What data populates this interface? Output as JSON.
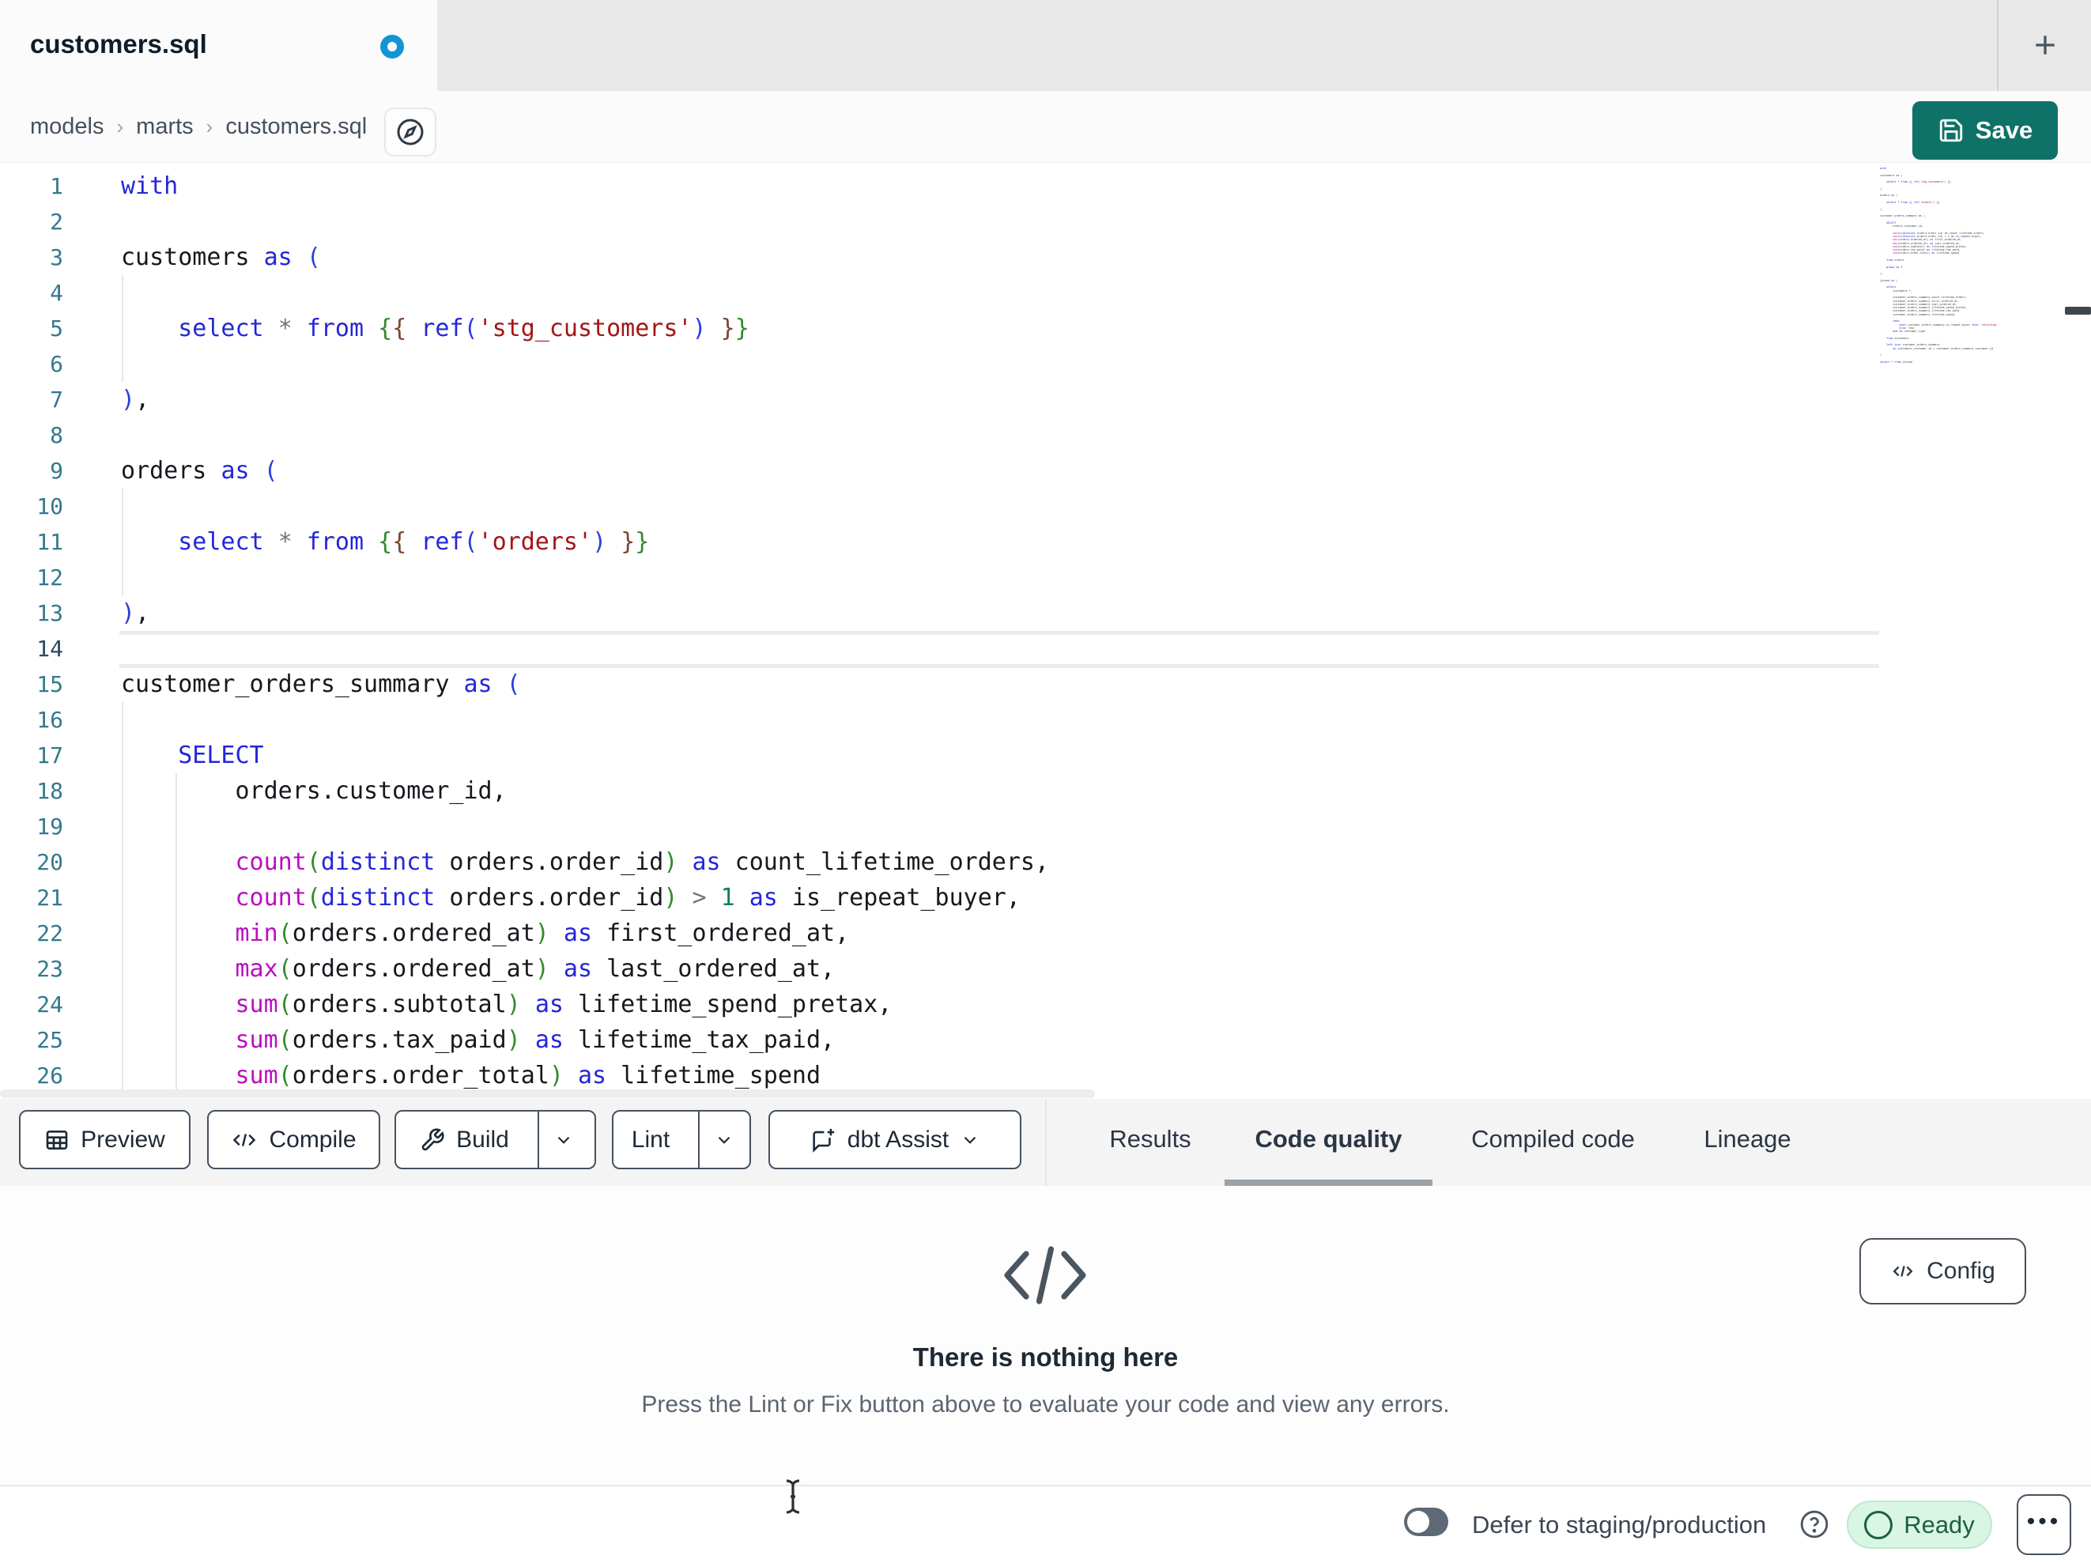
{
  "tab_bar": {
    "tab_title": "customers.sql",
    "unsaved": true,
    "new_tab_label": "+"
  },
  "breadcrumb": {
    "items": [
      "models",
      "marts",
      "customers.sql"
    ],
    "separator": "›"
  },
  "save_button": {
    "label": "Save"
  },
  "toolbar": {
    "preview_label": "Preview",
    "compile_label": "Compile",
    "build_label": "Build",
    "lint_label": "Lint",
    "assist_label": "dbt Assist"
  },
  "tabs": {
    "items": [
      {
        "label": "Results",
        "active": false
      },
      {
        "label": "Code quality",
        "active": true
      },
      {
        "label": "Compiled code",
        "active": false
      },
      {
        "label": "Lineage",
        "active": false
      }
    ]
  },
  "panel": {
    "title": "There is nothing here",
    "subtitle": "Press the Lint or Fix button above to evaluate your code and view any errors.",
    "config_label": "Config"
  },
  "statusbar": {
    "defer_label": "Defer to staging/production",
    "ready_label": "Ready"
  },
  "colors": {
    "accent_teal": "#0f7268",
    "unsaved_dot_blue": "#1495d3",
    "ready_green_bg": "#d9f6e4",
    "ready_green_text": "#1e5f43",
    "keyword_blue": "#2426d8",
    "function_magenta": "#bb0fbe",
    "string_red": "#a31515",
    "number_teal": "#0c7f65"
  },
  "editor": {
    "active_line": 14,
    "lines": [
      {
        "n": 1,
        "tokens": [
          [
            "kw",
            "with"
          ]
        ]
      },
      {
        "n": 2,
        "tokens": []
      },
      {
        "n": 3,
        "tokens": [
          [
            "txt",
            "customers "
          ],
          [
            "kw",
            "as"
          ],
          [
            "txt",
            " "
          ],
          [
            "blu",
            "("
          ]
        ]
      },
      {
        "n": 4,
        "tokens": []
      },
      {
        "n": 5,
        "tokens": [
          [
            "txt",
            "    "
          ],
          [
            "kw",
            "select"
          ],
          [
            "txt",
            " "
          ],
          [
            "op",
            "*"
          ],
          [
            "txt",
            " "
          ],
          [
            "kw",
            "from"
          ],
          [
            "txt",
            " "
          ],
          [
            "grn",
            "{"
          ],
          [
            "brn",
            "{"
          ],
          [
            "txt",
            " "
          ],
          [
            "kw",
            "ref"
          ],
          [
            "blu",
            "("
          ],
          [
            "str",
            "'stg_customers'"
          ],
          [
            "blu",
            ")"
          ],
          [
            "txt",
            " "
          ],
          [
            "brn",
            "}"
          ],
          [
            "grn",
            "}"
          ]
        ]
      },
      {
        "n": 6,
        "tokens": []
      },
      {
        "n": 7,
        "tokens": [
          [
            "blu",
            ")"
          ],
          [
            "txt",
            ","
          ]
        ]
      },
      {
        "n": 8,
        "tokens": []
      },
      {
        "n": 9,
        "tokens": [
          [
            "txt",
            "orders "
          ],
          [
            "kw",
            "as"
          ],
          [
            "txt",
            " "
          ],
          [
            "blu",
            "("
          ]
        ]
      },
      {
        "n": 10,
        "tokens": []
      },
      {
        "n": 11,
        "tokens": [
          [
            "txt",
            "    "
          ],
          [
            "kw",
            "select"
          ],
          [
            "txt",
            " "
          ],
          [
            "op",
            "*"
          ],
          [
            "txt",
            " "
          ],
          [
            "kw",
            "from"
          ],
          [
            "txt",
            " "
          ],
          [
            "grn",
            "{"
          ],
          [
            "brn",
            "{"
          ],
          [
            "txt",
            " "
          ],
          [
            "kw",
            "ref"
          ],
          [
            "blu",
            "("
          ],
          [
            "str",
            "'orders'"
          ],
          [
            "blu",
            ")"
          ],
          [
            "txt",
            " "
          ],
          [
            "brn",
            "}"
          ],
          [
            "grn",
            "}"
          ]
        ]
      },
      {
        "n": 12,
        "tokens": []
      },
      {
        "n": 13,
        "tokens": [
          [
            "blu",
            ")"
          ],
          [
            "txt",
            ","
          ]
        ]
      },
      {
        "n": 14,
        "tokens": []
      },
      {
        "n": 15,
        "tokens": [
          [
            "txt",
            "customer_orders_summary "
          ],
          [
            "kw",
            "as"
          ],
          [
            "txt",
            " "
          ],
          [
            "blu",
            "("
          ]
        ]
      },
      {
        "n": 16,
        "tokens": []
      },
      {
        "n": 17,
        "tokens": [
          [
            "txt",
            "    "
          ],
          [
            "kw",
            "SELECT"
          ]
        ]
      },
      {
        "n": 18,
        "tokens": [
          [
            "txt",
            "        orders.customer_id,"
          ]
        ]
      },
      {
        "n": 19,
        "tokens": []
      },
      {
        "n": 20,
        "tokens": [
          [
            "txt",
            "        "
          ],
          [
            "fn",
            "count"
          ],
          [
            "grn",
            "("
          ],
          [
            "kw",
            "distinct"
          ],
          [
            "txt",
            " orders.order_id"
          ],
          [
            "grn",
            ")"
          ],
          [
            "txt",
            " "
          ],
          [
            "kw",
            "as"
          ],
          [
            "txt",
            " count_lifetime_orders,"
          ]
        ]
      },
      {
        "n": 21,
        "tokens": [
          [
            "txt",
            "        "
          ],
          [
            "fn",
            "count"
          ],
          [
            "grn",
            "("
          ],
          [
            "kw",
            "distinct"
          ],
          [
            "txt",
            " orders.order_id"
          ],
          [
            "grn",
            ")"
          ],
          [
            "txt",
            " "
          ],
          [
            "op",
            ">"
          ],
          [
            "txt",
            " "
          ],
          [
            "num",
            "1"
          ],
          [
            "txt",
            " "
          ],
          [
            "kw",
            "as"
          ],
          [
            "txt",
            " is_repeat_buyer,"
          ]
        ]
      },
      {
        "n": 22,
        "tokens": [
          [
            "txt",
            "        "
          ],
          [
            "fn",
            "min"
          ],
          [
            "grn",
            "("
          ],
          [
            "txt",
            "orders.ordered_at"
          ],
          [
            "grn",
            ")"
          ],
          [
            "txt",
            " "
          ],
          [
            "kw",
            "as"
          ],
          [
            "txt",
            " first_ordered_at,"
          ]
        ]
      },
      {
        "n": 23,
        "tokens": [
          [
            "txt",
            "        "
          ],
          [
            "fn",
            "max"
          ],
          [
            "grn",
            "("
          ],
          [
            "txt",
            "orders.ordered_at"
          ],
          [
            "grn",
            ")"
          ],
          [
            "txt",
            " "
          ],
          [
            "kw",
            "as"
          ],
          [
            "txt",
            " last_ordered_at,"
          ]
        ]
      },
      {
        "n": 24,
        "tokens": [
          [
            "txt",
            "        "
          ],
          [
            "fn",
            "sum"
          ],
          [
            "grn",
            "("
          ],
          [
            "txt",
            "orders.subtotal"
          ],
          [
            "grn",
            ")"
          ],
          [
            "txt",
            " "
          ],
          [
            "kw",
            "as"
          ],
          [
            "txt",
            " lifetime_spend_pretax,"
          ]
        ]
      },
      {
        "n": 25,
        "tokens": [
          [
            "txt",
            "        "
          ],
          [
            "fn",
            "sum"
          ],
          [
            "grn",
            "("
          ],
          [
            "txt",
            "orders.tax_paid"
          ],
          [
            "grn",
            ")"
          ],
          [
            "txt",
            " "
          ],
          [
            "kw",
            "as"
          ],
          [
            "txt",
            " lifetime_tax_paid,"
          ]
        ]
      },
      {
        "n": 26,
        "tokens": [
          [
            "txt",
            "        "
          ],
          [
            "fn",
            "sum"
          ],
          [
            "grn",
            "("
          ],
          [
            "txt",
            "orders.order_total"
          ],
          [
            "grn",
            ")"
          ],
          [
            "txt",
            " "
          ],
          [
            "kw",
            "as"
          ],
          [
            "txt",
            " lifetime_spend"
          ]
        ]
      }
    ],
    "minimap_code": "with\n\ncustomers as (\n\n    select * from {{ ref('stg_customers') }}\n\n),\n\norders as (\n\n    select * from {{ ref('orders') }}\n\n),\n\ncustomer_orders_summary as (\n\n    SELECT\n        orders.customer_id,\n\n        count(distinct orders.order_id) as count_lifetime_orders,\n        count(distinct orders.order_id) > 1 as is_repeat_buyer,\n        min(orders.ordered_at) as first_ordered_at,\n        max(orders.ordered_at) as last_ordered_at,\n        sum(orders.subtotal) as lifetime_spend_pretax,\n        sum(orders.tax_paid) as lifetime_tax_paid,\n        sum(orders.order_total) as lifetime_spend\n\n    from orders\n\n    group by 1\n\n),\n\njoined as (\n\n    select\n        customers.*,\n\n        customer_orders_summary.count_lifetime_orders,\n        customer_orders_summary.first_ordered_at,\n        customer_orders_summary.last_ordered_at,\n        customer_orders_summary.lifetime_spend_pretax,\n        customer_orders_summary.lifetime_tax_paid,\n        customer_orders_summary.lifetime_spend,\n\n        case\n            when customer_orders_summary.is_repeat_buyer then 'returning'\n            else 'new'\n        end as customer_type\n\n    from customers\n\n    left join customer_orders_summary\n        on customers.customer_id = customer_orders_summary.customer_id\n\n)\n\nselect * from joined"
  }
}
